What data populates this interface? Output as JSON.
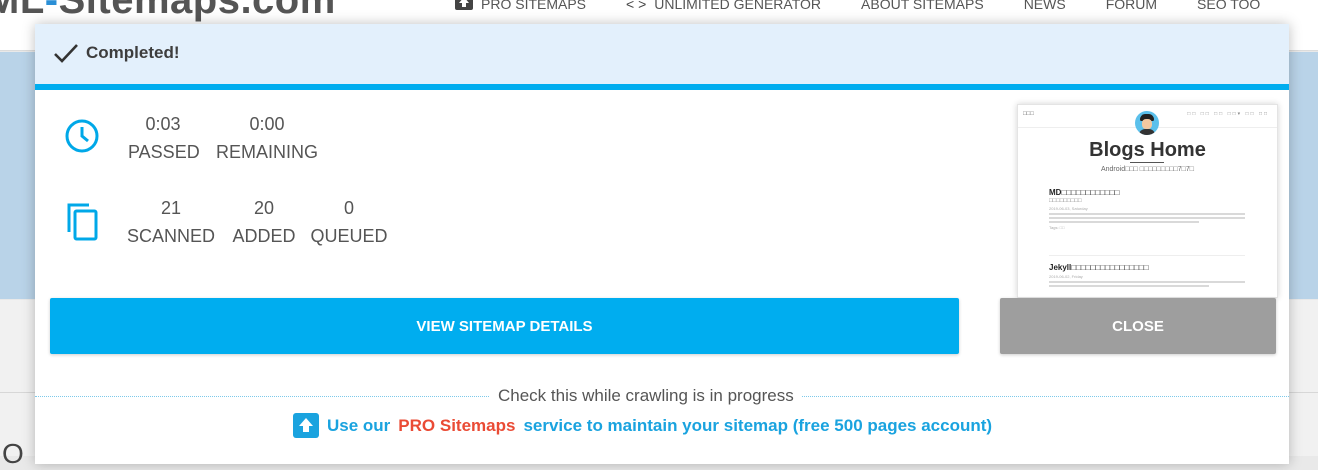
{
  "site": {
    "logo_prefix": "ML",
    "logo_dash": "-",
    "logo_text": "Sitemaps.com",
    "nav": [
      {
        "icon": "upload-icon",
        "label": "PRO SITEMAPS"
      },
      {
        "icon": "code-icon",
        "label": "UNLIMITED GENERATOR"
      },
      {
        "icon": "",
        "label": "ABOUT SITEMAPS"
      },
      {
        "icon": "",
        "label": "NEWS"
      },
      {
        "icon": "",
        "label": "FORUM"
      },
      {
        "icon": "",
        "label": "SEO TOO"
      }
    ],
    "lower_stub": "O"
  },
  "modal": {
    "status_icon": "check-icon",
    "title": "Completed!",
    "accent_color": "#00adef",
    "time": {
      "icon": "clock-icon",
      "passed_value": "0:03",
      "passed_label": "PASSED",
      "remaining_value": "0:00",
      "remaining_label": "REMAINING"
    },
    "pages": {
      "icon": "copy-icon",
      "scanned_value": "21",
      "scanned_label": "SCANNED",
      "added_value": "20",
      "added_label": "ADDED",
      "queued_value": "0",
      "queued_label": "QUEUED"
    },
    "preview": {
      "bar_left": "□□□",
      "bar_right": "□□ □□ □□ □□▾ □□ □□",
      "title": "Blogs Home",
      "subtitle": "Android□□□ □□□□□□□□□7□7□",
      "post1_title": "MD□□□□□□□□□□□□",
      "post1_sub": "□□□□□□□□□",
      "post1_date": "2019-06-03, Saturday",
      "post1_tag": "Tags: □□",
      "post2_title": "Jekyll□□□□□□□□□□□□□□□□",
      "post2_date": "2019-06-02, Friday"
    },
    "view_button": "VIEW SITEMAP DETAILS",
    "close_button": "CLOSE",
    "hint": "Check this while crawling is in progress",
    "promo": {
      "icon": "upload-icon",
      "before": "Use our",
      "pro": "PRO Sitemaps",
      "after": "service to maintain your sitemap (free 500 pages account)"
    },
    "colors": {
      "header_bg": "#e3f0fc",
      "primary": "#00adef",
      "close": "#9e9e9e",
      "pro": "#ea4b35"
    }
  }
}
